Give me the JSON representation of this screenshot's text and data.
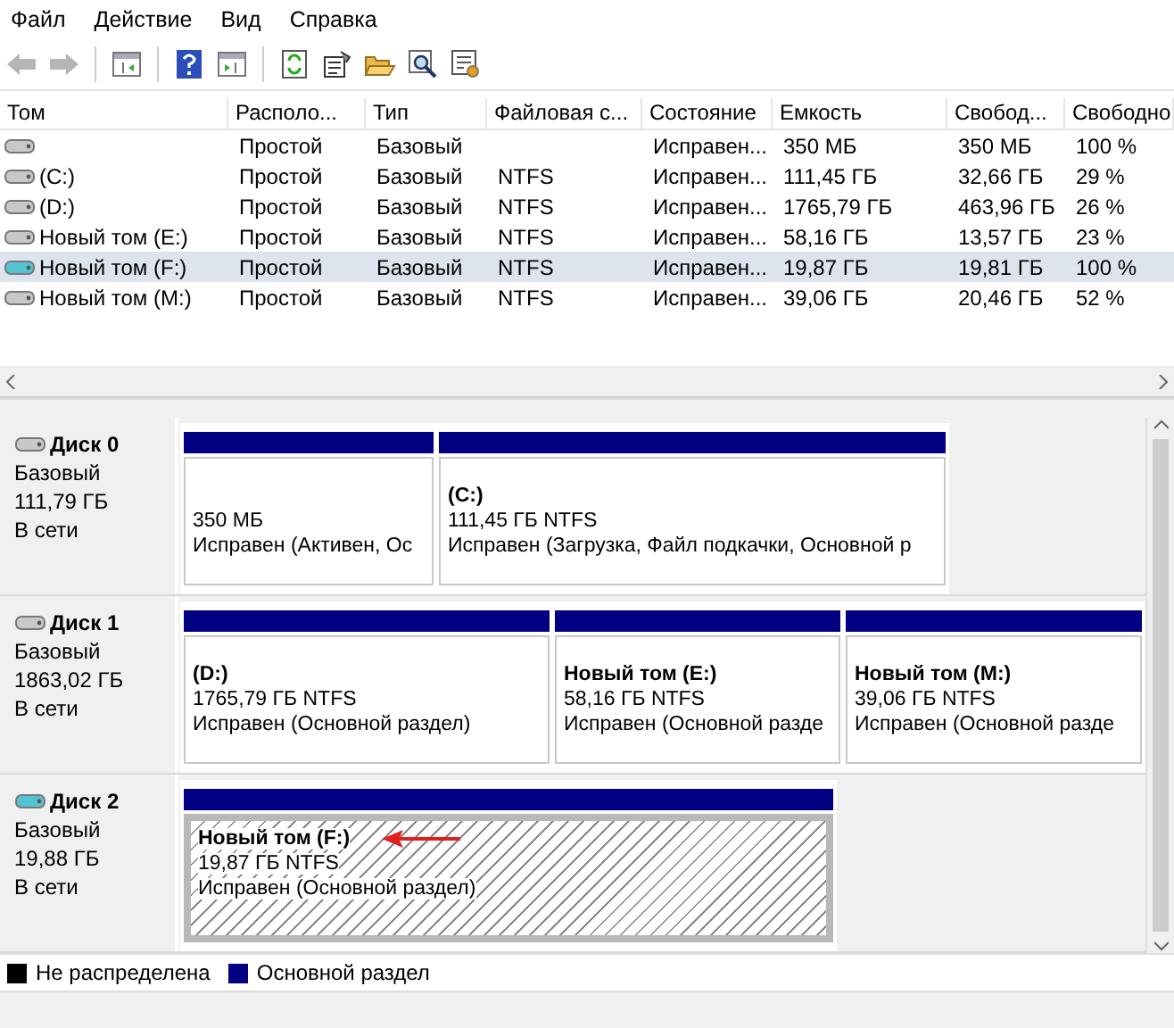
{
  "menu": [
    "Файл",
    "Действие",
    "Вид",
    "Справка"
  ],
  "table": {
    "columns": [
      "Том",
      "Располо...",
      "Тип",
      "Файловая с...",
      "Состояние",
      "Емкость",
      "Свобод...",
      "Свободно"
    ],
    "rows": [
      {
        "kind": "fixed",
        "selected": false,
        "cells": [
          "",
          "Простой",
          "Базовый",
          "",
          "Исправен...",
          "350 МБ",
          "350 МБ",
          "100 %"
        ]
      },
      {
        "kind": "fixed",
        "selected": false,
        "cells": [
          "(C:)",
          "Простой",
          "Базовый",
          "NTFS",
          "Исправен...",
          "111,45 ГБ",
          "32,66 ГБ",
          "29 %"
        ]
      },
      {
        "kind": "fixed",
        "selected": false,
        "cells": [
          "(D:)",
          "Простой",
          "Базовый",
          "NTFS",
          "Исправен...",
          "1765,79 ГБ",
          "463,96 ГБ",
          "26 %"
        ]
      },
      {
        "kind": "fixed",
        "selected": false,
        "cells": [
          "Новый том (E:)",
          "Простой",
          "Базовый",
          "NTFS",
          "Исправен...",
          "58,16 ГБ",
          "13,57 ГБ",
          "23 %"
        ]
      },
      {
        "kind": "removable",
        "selected": true,
        "cells": [
          "Новый том (F:)",
          "Простой",
          "Базовый",
          "NTFS",
          "Исправен...",
          "19,87 ГБ",
          "19,81 ГБ",
          "100 %"
        ]
      },
      {
        "kind": "fixed",
        "selected": false,
        "cells": [
          "Новый том (M:)",
          "Простой",
          "Базовый",
          "NTFS",
          "Исправен...",
          "39,06 ГБ",
          "20,46 ГБ",
          "52 %"
        ]
      }
    ]
  },
  "disks": [
    {
      "kind": "fixed",
      "name": "Диск 0",
      "type": "Базовый",
      "size": "111,79 ГБ",
      "status": "В сети",
      "partitions": [
        {
          "size": "350 МБ",
          "status": "Исправен (Активен, Ос",
          "selected": false
        },
        {
          "name": "(C:)",
          "size": "111,45 ГБ NTFS",
          "status": "Исправен (Загрузка, Файл подкачки, Основной р",
          "selected": false
        }
      ]
    },
    {
      "kind": "fixed",
      "name": "Диск 1",
      "type": "Базовый",
      "size": "1863,02 ГБ",
      "status": "В сети",
      "partitions": [
        {
          "name": "(D:)",
          "size": "1765,79 ГБ NTFS",
          "status": "Исправен (Основной раздел)",
          "selected": false
        },
        {
          "name": "Новый том  (E:)",
          "size": "58,16 ГБ NTFS",
          "status": "Исправен (Основной разде",
          "selected": false
        },
        {
          "name": "Новый том  (M:)",
          "size": "39,06 ГБ NTFS",
          "status": "Исправен (Основной разде",
          "selected": false
        }
      ]
    },
    {
      "kind": "removable",
      "name": "Диск 2",
      "type": "Базовый",
      "size": "19,88 ГБ",
      "status": "В сети",
      "partitions": [
        {
          "name": "Новый том  (F:)",
          "size": "19,87 ГБ NTFS",
          "status": "Исправен (Основной раздел)",
          "selected": true,
          "pointer": true
        }
      ]
    }
  ],
  "legend": [
    {
      "label": "Не распределена",
      "color": "#000000"
    },
    {
      "label": "Основной раздел",
      "color": "#000080"
    }
  ]
}
